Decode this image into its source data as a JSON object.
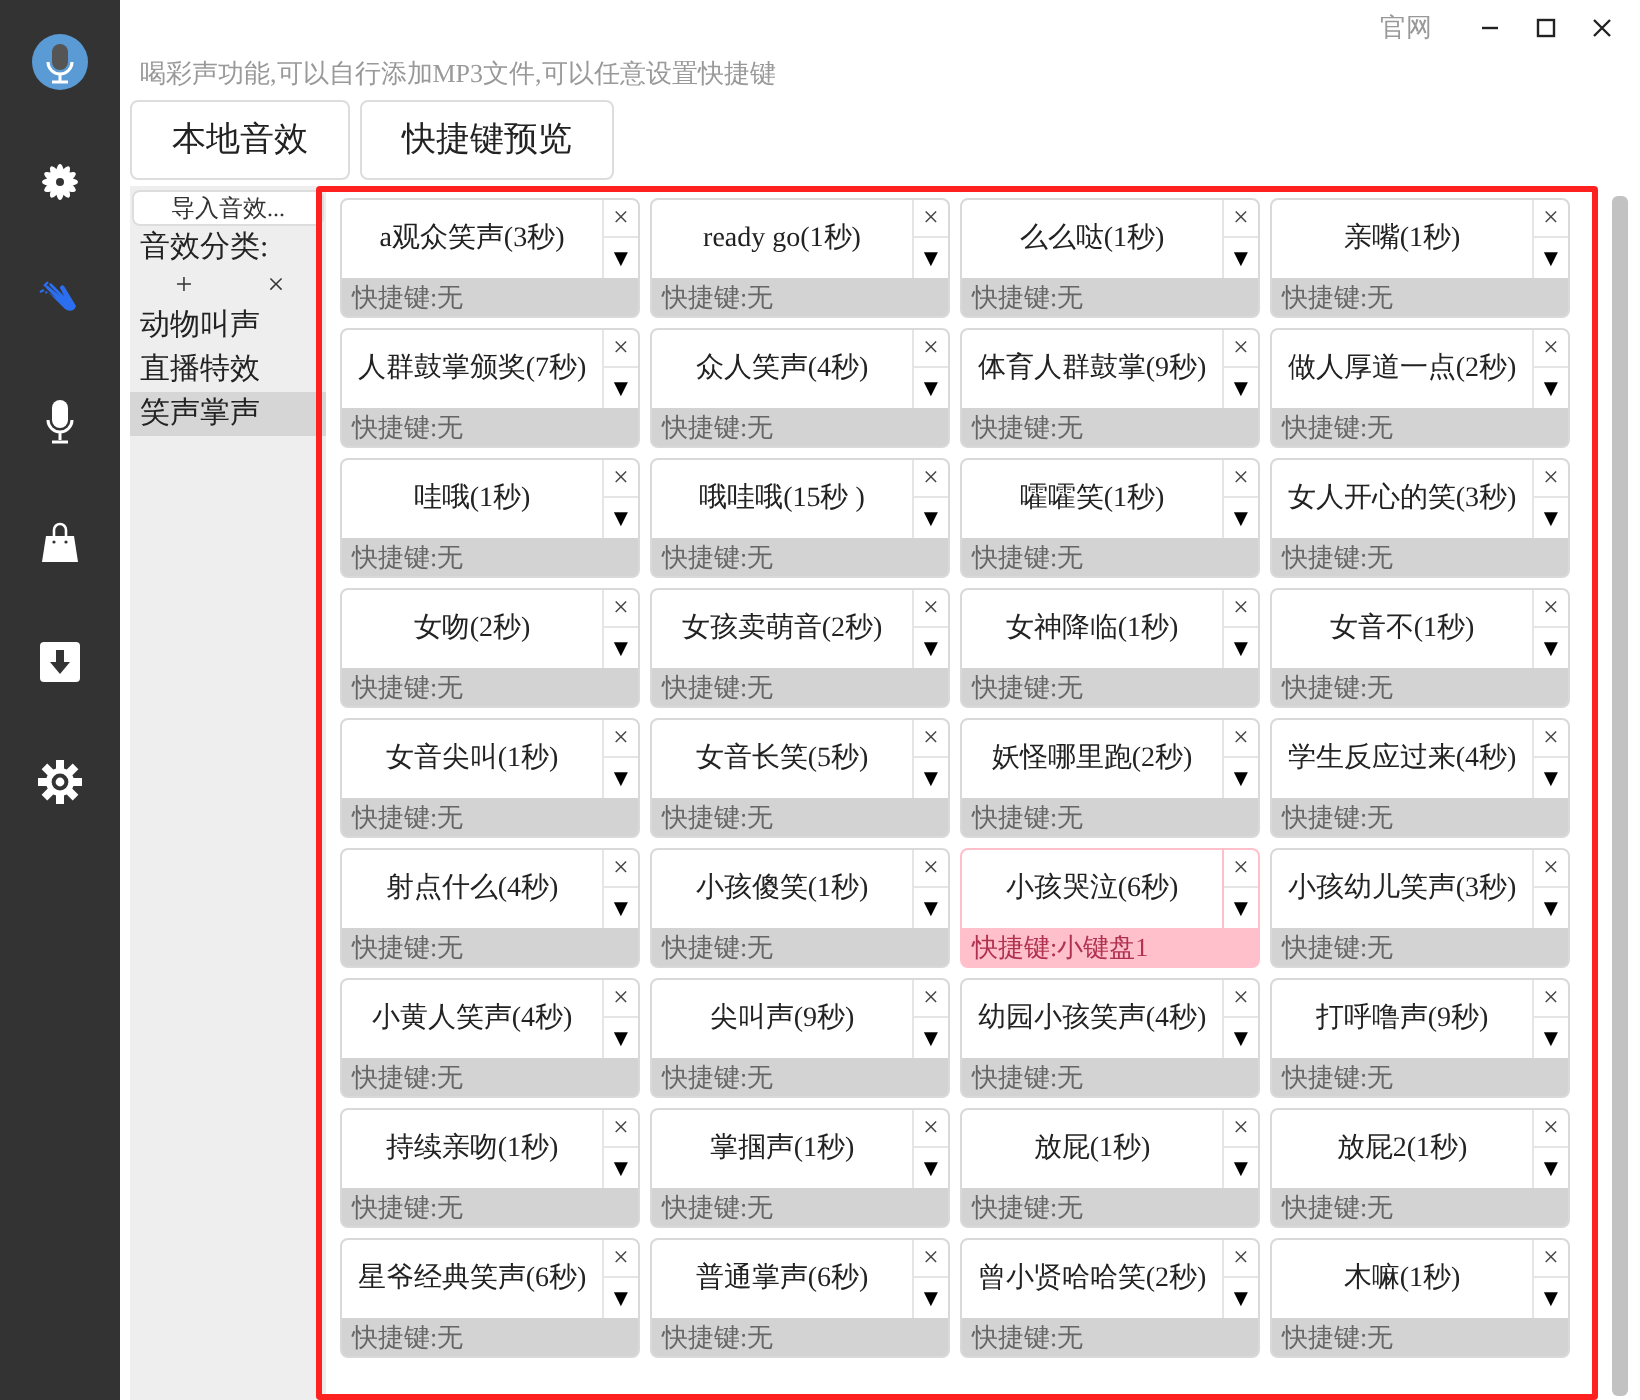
{
  "title_bar": {
    "link": "官网"
  },
  "subtitle": "喝彩声功能,可以自行添加MP3文件,可以任意设置快捷键",
  "sidebar": {
    "items": [
      {
        "kind": "logo",
        "selected": false
      },
      {
        "kind": "flower",
        "selected": false
      },
      {
        "kind": "clap",
        "selected": true
      },
      {
        "kind": "mic",
        "selected": false
      },
      {
        "kind": "bag",
        "selected": false
      },
      {
        "kind": "download",
        "selected": false
      },
      {
        "kind": "gear",
        "selected": false
      }
    ]
  },
  "tabs": [
    {
      "label": "本地音效"
    },
    {
      "label": "快捷键预览"
    }
  ],
  "left_panel": {
    "import_button": "导入音效...",
    "category_label": "音效分类:",
    "add": "+",
    "remove": "×",
    "categories": [
      {
        "label": "动物叫声",
        "selected": false
      },
      {
        "label": "直播特效",
        "selected": false
      },
      {
        "label": "笑声掌声",
        "selected": true
      }
    ]
  },
  "sounds": [
    {
      "name": "a观众笑声(3秒)",
      "hotkey": "快捷键:无",
      "highlighted": false
    },
    {
      "name": "ready go(1秒)",
      "hotkey": "快捷键:无",
      "highlighted": false
    },
    {
      "name": "么么哒(1秒)",
      "hotkey": "快捷键:无",
      "highlighted": false
    },
    {
      "name": "亲嘴(1秒)",
      "hotkey": "快捷键:无",
      "highlighted": false
    },
    {
      "name": "人群鼓掌颁奖(7秒)",
      "hotkey": "快捷键:无",
      "highlighted": false
    },
    {
      "name": "众人笑声(4秒)",
      "hotkey": "快捷键:无",
      "highlighted": false
    },
    {
      "name": "体育人群鼓掌(9秒)",
      "hotkey": "快捷键:无",
      "highlighted": false
    },
    {
      "name": "做人厚道一点(2秒)",
      "hotkey": "快捷键:无",
      "highlighted": false
    },
    {
      "name": "哇哦(1秒)",
      "hotkey": "快捷键:无",
      "highlighted": false
    },
    {
      "name": "哦哇哦(15秒 )",
      "hotkey": "快捷键:无",
      "highlighted": false
    },
    {
      "name": "嚯嚯笑(1秒)",
      "hotkey": "快捷键:无",
      "highlighted": false
    },
    {
      "name": "女人开心的笑(3秒)",
      "hotkey": "快捷键:无",
      "highlighted": false
    },
    {
      "name": "女吻(2秒)",
      "hotkey": "快捷键:无",
      "highlighted": false
    },
    {
      "name": "女孩卖萌音(2秒)",
      "hotkey": "快捷键:无",
      "highlighted": false
    },
    {
      "name": "女神降临(1秒)",
      "hotkey": "快捷键:无",
      "highlighted": false
    },
    {
      "name": "女音不(1秒)",
      "hotkey": "快捷键:无",
      "highlighted": false
    },
    {
      "name": "女音尖叫(1秒)",
      "hotkey": "快捷键:无",
      "highlighted": false
    },
    {
      "name": "女音长笑(5秒)",
      "hotkey": "快捷键:无",
      "highlighted": false
    },
    {
      "name": "妖怪哪里跑(2秒)",
      "hotkey": "快捷键:无",
      "highlighted": false
    },
    {
      "name": "学生反应过来(4秒)",
      "hotkey": "快捷键:无",
      "highlighted": false
    },
    {
      "name": "射点什么(4秒)",
      "hotkey": "快捷键:无",
      "highlighted": false
    },
    {
      "name": "小孩傻笑(1秒)",
      "hotkey": "快捷键:无",
      "highlighted": false
    },
    {
      "name": "小孩哭泣(6秒)",
      "hotkey": "快捷键:小键盘1",
      "highlighted": true
    },
    {
      "name": "小孩幼儿笑声(3秒)",
      "hotkey": "快捷键:无",
      "highlighted": false
    },
    {
      "name": "小黄人笑声(4秒)",
      "hotkey": "快捷键:无",
      "highlighted": false
    },
    {
      "name": "尖叫声(9秒)",
      "hotkey": "快捷键:无",
      "highlighted": false
    },
    {
      "name": "幼园小孩笑声(4秒)",
      "hotkey": "快捷键:无",
      "highlighted": false
    },
    {
      "name": "打呼噜声(9秒)",
      "hotkey": "快捷键:无",
      "highlighted": false
    },
    {
      "name": "持续亲吻(1秒)",
      "hotkey": "快捷键:无",
      "highlighted": false
    },
    {
      "name": "掌掴声(1秒)",
      "hotkey": "快捷键:无",
      "highlighted": false
    },
    {
      "name": "放屁(1秒)",
      "hotkey": "快捷键:无",
      "highlighted": false
    },
    {
      "name": "放屁2(1秒)",
      "hotkey": "快捷键:无",
      "highlighted": false
    },
    {
      "name": "星爷经典笑声(6秒)",
      "hotkey": "快捷键:无",
      "highlighted": false
    },
    {
      "name": "普通掌声(6秒)",
      "hotkey": "快捷键:无",
      "highlighted": false
    },
    {
      "name": "曾小贤哈哈笑(2秒)",
      "hotkey": "快捷键:无",
      "highlighted": false
    },
    {
      "name": "木嘛(1秒)",
      "hotkey": "快捷键:无",
      "highlighted": false
    }
  ],
  "card_controls": {
    "delete": "×",
    "menu": "▼"
  }
}
